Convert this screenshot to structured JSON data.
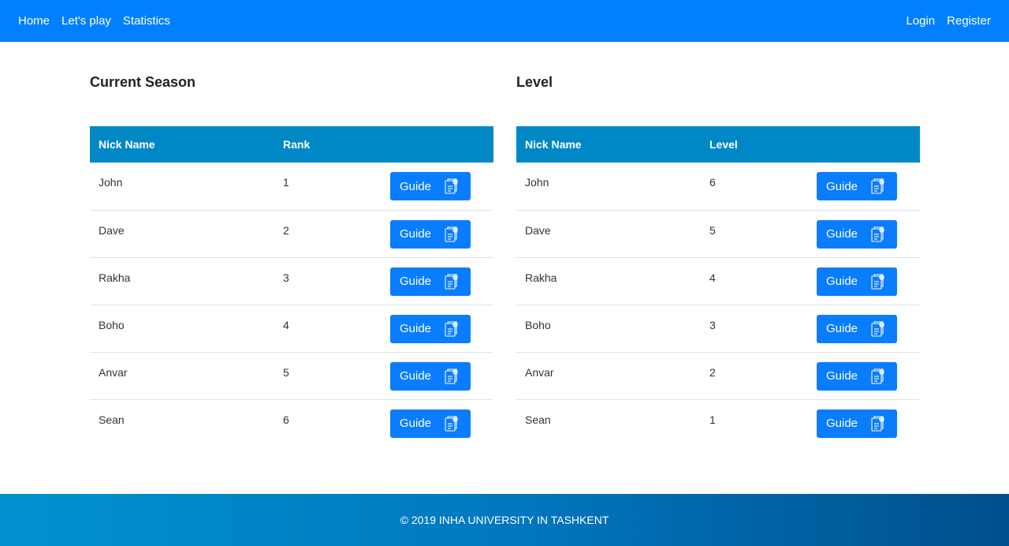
{
  "nav": {
    "left": [
      "Home",
      "Let's play",
      "Statistics"
    ],
    "right": [
      "Login",
      "Register"
    ]
  },
  "season": {
    "title": "Current Season",
    "headers": [
      "Nick Name",
      "Rank"
    ],
    "rows": [
      {
        "name": "John",
        "value": "1",
        "button": "Guide"
      },
      {
        "name": "Dave",
        "value": "2",
        "button": "Guide"
      },
      {
        "name": "Rakha",
        "value": "3",
        "button": "Guide"
      },
      {
        "name": "Boho",
        "value": "4",
        "button": "Guide"
      },
      {
        "name": "Anvar",
        "value": "5",
        "button": "Guide"
      },
      {
        "name": "Sean",
        "value": "6",
        "button": "Guide"
      }
    ]
  },
  "level": {
    "title": "Level",
    "headers": [
      "Nick Name",
      "Level"
    ],
    "rows": [
      {
        "name": "John",
        "value": "6",
        "button": "Guide"
      },
      {
        "name": "Dave",
        "value": "5",
        "button": "Guide"
      },
      {
        "name": "Rakha",
        "value": "4",
        "button": "Guide"
      },
      {
        "name": "Boho",
        "value": "3",
        "button": "Guide"
      },
      {
        "name": "Anvar",
        "value": "2",
        "button": "Guide"
      },
      {
        "name": "Sean",
        "value": "1",
        "button": "Guide"
      }
    ]
  },
  "footer": {
    "text": "© 2019 INHA UNIVERSITY IN TASHKENT"
  },
  "colors": {
    "nav": "#0080ff",
    "table_header": "#0088c6",
    "button": "#0a7dff"
  },
  "icons": {
    "guide": "book-gear-icon"
  }
}
